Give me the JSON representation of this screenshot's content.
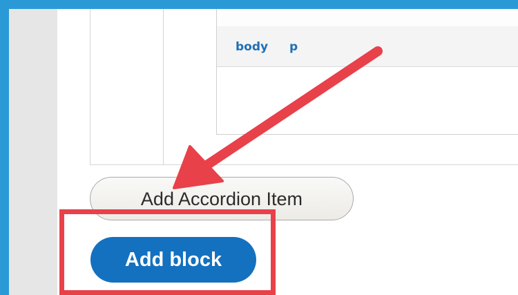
{
  "editor": {
    "path": [
      "body",
      "p"
    ]
  },
  "buttons": {
    "add_accordion_item": "Add Accordion Item",
    "add_block": "Add block"
  },
  "annotations": {
    "arrow_color": "#e8414a",
    "highlight_color": "#e8414a"
  }
}
